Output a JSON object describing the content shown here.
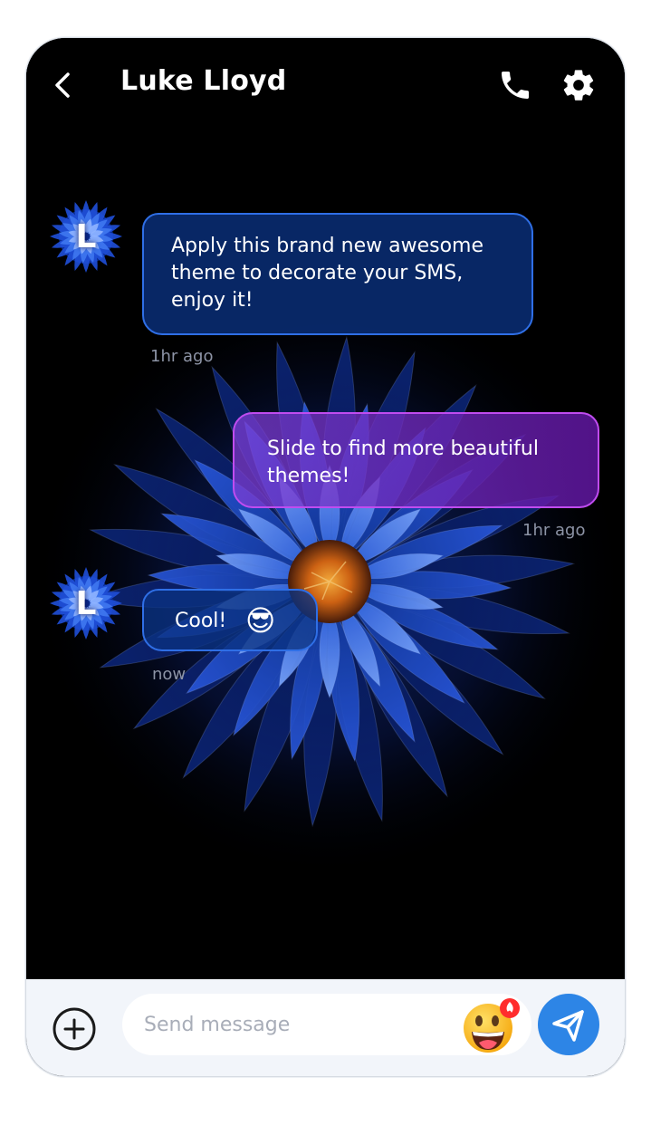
{
  "header": {
    "title": "Luke Lloyd"
  },
  "contact": {
    "avatar_letter": "L"
  },
  "messages": [
    {
      "direction": "incoming",
      "text": "Apply this brand new awesome theme to decorate your SMS, enjoy it!",
      "time": "1hr ago"
    },
    {
      "direction": "outgoing",
      "text": "Slide to find more beautiful themes!",
      "time": "1hr ago"
    },
    {
      "direction": "incoming",
      "text": "Cool!",
      "emoji": "😎",
      "time": "now"
    }
  ],
  "composer": {
    "placeholder": "Send message",
    "value": ""
  },
  "icons": {
    "back": "back-chevron-icon",
    "call": "phone-icon",
    "settings": "gear-icon",
    "add": "plus-circle-icon",
    "emoji": "emoji-picker-icon",
    "send": "send-icon"
  },
  "colors": {
    "incoming_border": "#2f6fe6",
    "outgoing_border": "#c04cf0",
    "send_button": "#2d85e6",
    "composer_bg": "#f2f5fa"
  }
}
